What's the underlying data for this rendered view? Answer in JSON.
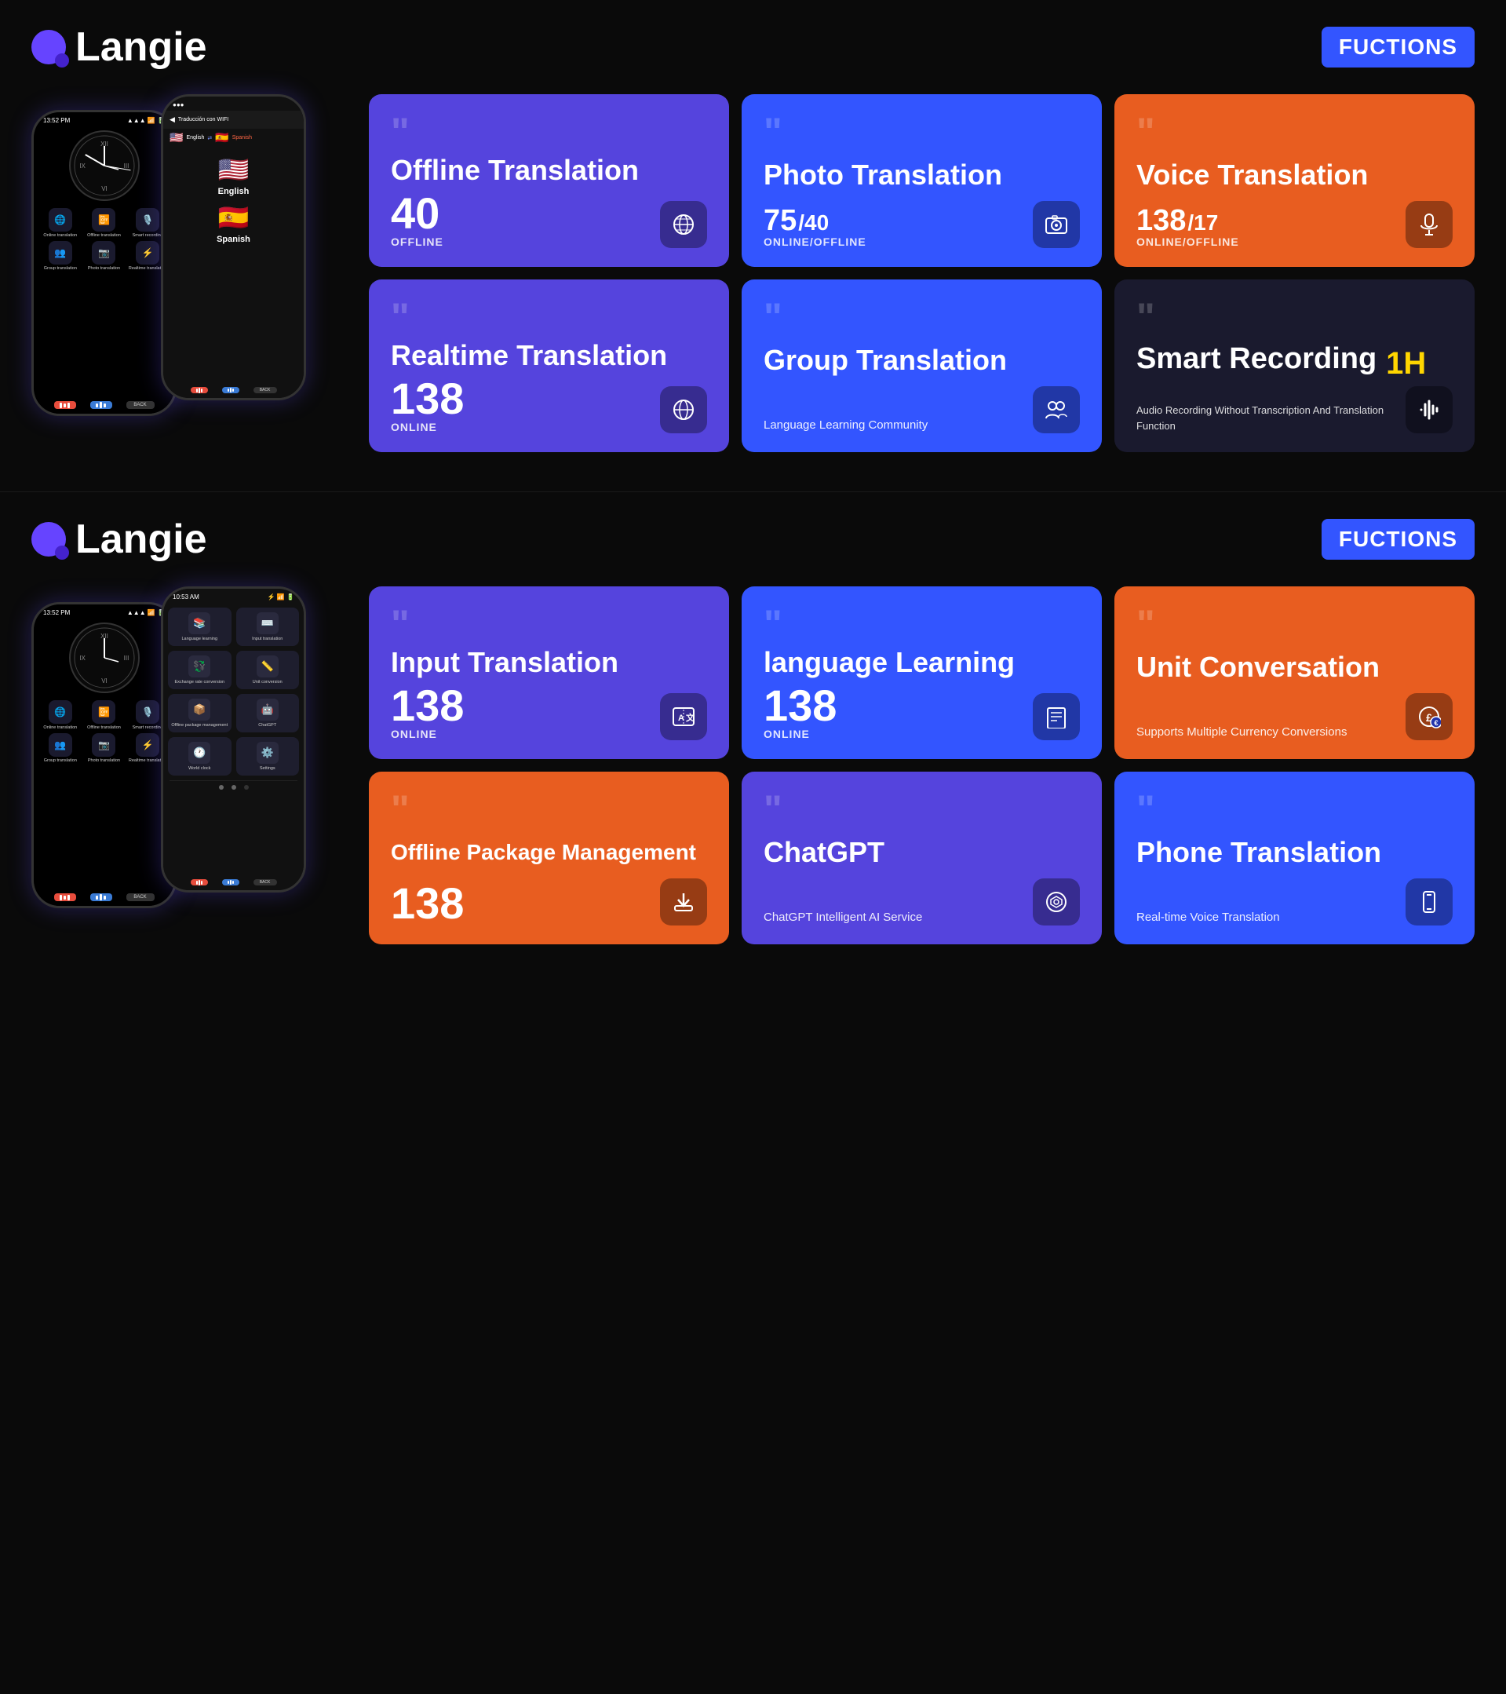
{
  "sections": [
    {
      "id": "section1",
      "logo": "Langie",
      "functions_badge": "FUCTIONS",
      "phone1": {
        "time": "13:52 PM",
        "icons": [
          {
            "label": "Online translation",
            "emoji": "🌐"
          },
          {
            "label": "Offline translation",
            "emoji": "📴"
          },
          {
            "label": "Smart recording",
            "emoji": "🎙️"
          },
          {
            "label": "Group translation",
            "emoji": "👥"
          },
          {
            "label": "Photo translation",
            "emoji": "📷"
          },
          {
            "label": "Realtime translation",
            "emoji": "⚡"
          }
        ]
      },
      "phone2": {
        "time": "...",
        "nav": "Traducción con WIFI",
        "lang_from": "English",
        "lang_to": "Spanish"
      },
      "cards": [
        {
          "id": "offline-translation",
          "color": "card-indigo",
          "title": "Offline Translation",
          "count": "40",
          "count_suffix": "",
          "status": "OFFLINE",
          "icon": "🌐"
        },
        {
          "id": "photo-translation",
          "color": "card-blue",
          "title": "Photo Translation",
          "count": "75",
          "count_suffix": "/40",
          "status": "ONLINE/OFFLINE",
          "icon": "📷"
        },
        {
          "id": "voice-translation",
          "color": "card-orange",
          "title": "Voice Translation",
          "count": "138",
          "count_suffix": "/17",
          "status": "ONLINE/OFFLINE",
          "icon": "🎙️"
        },
        {
          "id": "realtime-translation",
          "color": "card-indigo",
          "title": "Realtime Translation",
          "count": "138",
          "count_suffix": "",
          "status": "ONLINE",
          "icon": "🌐"
        },
        {
          "id": "group-translation",
          "color": "card-blue",
          "title": "Group Translation",
          "subtitle": "Language Learning Community",
          "icon": "👥"
        },
        {
          "id": "smart-recording",
          "color": "recording-card",
          "title": "Smart Recording",
          "highlight": "1H",
          "desc": "Audio Recording Without Transcription And Translation Function",
          "icon": "🎵"
        }
      ]
    },
    {
      "id": "section2",
      "logo": "Langie",
      "functions_badge": "FUCTIONS",
      "phone1": {
        "time": "13:52 PM"
      },
      "phone2": {
        "time": "10:53 AM",
        "menu": [
          {
            "label": "Language learning",
            "emoji": "📚"
          },
          {
            "label": "Input translation",
            "emoji": "⌨️"
          },
          {
            "label": "Exchange rate conversion",
            "emoji": "💱"
          },
          {
            "label": "Unit conversion",
            "emoji": "📏"
          },
          {
            "label": "Offline package management",
            "emoji": "📦"
          },
          {
            "label": "ChatGPT",
            "emoji": "🤖"
          },
          {
            "label": "World clock",
            "emoji": "🕐"
          },
          {
            "label": "Settings",
            "emoji": "⚙️"
          }
        ]
      },
      "cards": [
        {
          "id": "input-translation",
          "color": "card-indigo",
          "title": "Input Translation",
          "count": "138",
          "status": "ONLINE",
          "icon": "🔤"
        },
        {
          "id": "language-learning",
          "color": "card-blue",
          "title": "language Learning",
          "count": "138",
          "status": "ONLINE",
          "icon": "📚"
        },
        {
          "id": "unit-conversation",
          "color": "card-orange",
          "title": "Unit Conversation",
          "subtitle": "Supports Multiple Currency Conversions",
          "icon": "💱"
        },
        {
          "id": "offline-package",
          "color": "card-orange",
          "title": "Offline Package Management",
          "count": "138",
          "status": "",
          "icon": "⬇️"
        },
        {
          "id": "chatgpt",
          "color": "card-indigo",
          "title": "ChatGPT",
          "subtitle": "ChatGPT Intelligent AI Service",
          "icon": "🤖"
        },
        {
          "id": "phone-translation",
          "color": "card-blue",
          "title": "Phone Translation",
          "subtitle": "Real-time Voice Translation",
          "icon": "📱"
        }
      ]
    }
  ]
}
